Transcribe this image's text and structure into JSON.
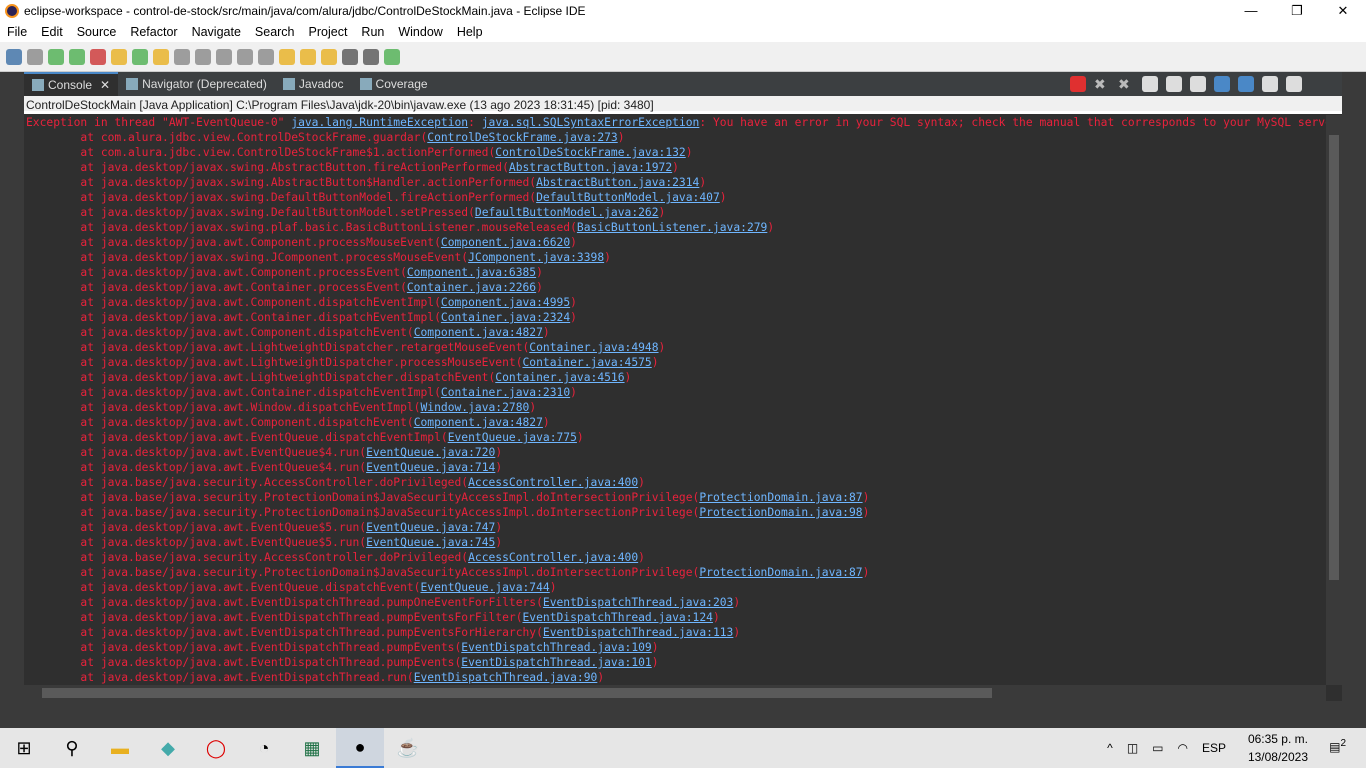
{
  "window": {
    "title": "eclipse-workspace - control-de-stock/src/main/java/com/alura/jdbc/ControlDeStockMain.java - Eclipse IDE",
    "minimize": "—",
    "maximize": "❐",
    "close": "✕"
  },
  "menu": [
    "File",
    "Edit",
    "Source",
    "Refactor",
    "Navigate",
    "Search",
    "Project",
    "Run",
    "Window",
    "Help"
  ],
  "tabs": [
    {
      "label": "Console",
      "icon": "console-icon",
      "active": true
    },
    {
      "label": "Navigator (Deprecated)",
      "icon": "navigator-icon"
    },
    {
      "label": "Javadoc",
      "icon": "javadoc-icon"
    },
    {
      "label": "Coverage",
      "icon": "coverage-icon"
    }
  ],
  "process_line": "ControlDeStockMain [Java Application] C:\\Program Files\\Java\\jdk-20\\bin\\javaw.exe  (13 ago 2023 18:31:45) [pid: 3480]",
  "console": {
    "exception_prefix": "Exception in thread \"AWT-EventQueue-0\" ",
    "exception_class": "java.lang.RuntimeException",
    "exception_sep": ": ",
    "cause_class": "java.sql.SQLSyntaxErrorException",
    "message": ": You have an error in your SQL syntax; check the manual that corresponds to your MySQL server version",
    "frames": [
      [
        "com.alura.jdbc.view.ControlDeStockFrame.guardar",
        "ControlDeStockFrame.java:273"
      ],
      [
        "com.alura.jdbc.view.ControlDeStockFrame$1.actionPerformed",
        "ControlDeStockFrame.java:132"
      ],
      [
        "java.desktop/javax.swing.AbstractButton.fireActionPerformed",
        "AbstractButton.java:1972"
      ],
      [
        "java.desktop/javax.swing.AbstractButton$Handler.actionPerformed",
        "AbstractButton.java:2314"
      ],
      [
        "java.desktop/javax.swing.DefaultButtonModel.fireActionPerformed",
        "DefaultButtonModel.java:407"
      ],
      [
        "java.desktop/javax.swing.DefaultButtonModel.setPressed",
        "DefaultButtonModel.java:262"
      ],
      [
        "java.desktop/javax.swing.plaf.basic.BasicButtonListener.mouseReleased",
        "BasicButtonListener.java:279"
      ],
      [
        "java.desktop/java.awt.Component.processMouseEvent",
        "Component.java:6620"
      ],
      [
        "java.desktop/javax.swing.JComponent.processMouseEvent",
        "JComponent.java:3398"
      ],
      [
        "java.desktop/java.awt.Component.processEvent",
        "Component.java:6385"
      ],
      [
        "java.desktop/java.awt.Container.processEvent",
        "Container.java:2266"
      ],
      [
        "java.desktop/java.awt.Component.dispatchEventImpl",
        "Component.java:4995"
      ],
      [
        "java.desktop/java.awt.Container.dispatchEventImpl",
        "Container.java:2324"
      ],
      [
        "java.desktop/java.awt.Component.dispatchEvent",
        "Component.java:4827"
      ],
      [
        "java.desktop/java.awt.LightweightDispatcher.retargetMouseEvent",
        "Container.java:4948"
      ],
      [
        "java.desktop/java.awt.LightweightDispatcher.processMouseEvent",
        "Container.java:4575"
      ],
      [
        "java.desktop/java.awt.LightweightDispatcher.dispatchEvent",
        "Container.java:4516"
      ],
      [
        "java.desktop/java.awt.Container.dispatchEventImpl",
        "Container.java:2310"
      ],
      [
        "java.desktop/java.awt.Window.dispatchEventImpl",
        "Window.java:2780"
      ],
      [
        "java.desktop/java.awt.Component.dispatchEvent",
        "Component.java:4827"
      ],
      [
        "java.desktop/java.awt.EventQueue.dispatchEventImpl",
        "EventQueue.java:775"
      ],
      [
        "java.desktop/java.awt.EventQueue$4.run",
        "EventQueue.java:720"
      ],
      [
        "java.desktop/java.awt.EventQueue$4.run",
        "EventQueue.java:714"
      ],
      [
        "java.base/java.security.AccessController.doPrivileged",
        "AccessController.java:400"
      ],
      [
        "java.base/java.security.ProtectionDomain$JavaSecurityAccessImpl.doIntersectionPrivilege",
        "ProtectionDomain.java:87"
      ],
      [
        "java.base/java.security.ProtectionDomain$JavaSecurityAccessImpl.doIntersectionPrivilege",
        "ProtectionDomain.java:98"
      ],
      [
        "java.desktop/java.awt.EventQueue$5.run",
        "EventQueue.java:747"
      ],
      [
        "java.desktop/java.awt.EventQueue$5.run",
        "EventQueue.java:745"
      ],
      [
        "java.base/java.security.AccessController.doPrivileged",
        "AccessController.java:400"
      ],
      [
        "java.base/java.security.ProtectionDomain$JavaSecurityAccessImpl.doIntersectionPrivilege",
        "ProtectionDomain.java:87"
      ],
      [
        "java.desktop/java.awt.EventQueue.dispatchEvent",
        "EventQueue.java:744"
      ],
      [
        "java.desktop/java.awt.EventDispatchThread.pumpOneEventForFilters",
        "EventDispatchThread.java:203"
      ],
      [
        "java.desktop/java.awt.EventDispatchThread.pumpEventsForFilter",
        "EventDispatchThread.java:124"
      ],
      [
        "java.desktop/java.awt.EventDispatchThread.pumpEventsForHierarchy",
        "EventDispatchThread.java:113"
      ],
      [
        "java.desktop/java.awt.EventDispatchThread.pumpEvents",
        "EventDispatchThread.java:109"
      ],
      [
        "java.desktop/java.awt.EventDispatchThread.pumpEvents",
        "EventDispatchThread.java:101"
      ],
      [
        "java.desktop/java.awt.EventDispatchThread.run",
        "EventDispatchThread.java:90"
      ]
    ]
  },
  "colors": {
    "error": "#e8223c",
    "link": "#6fb6ff",
    "console_bg": "#2f2f2f"
  },
  "taskbar": {
    "language": "ESP",
    "time": "06:35 p. m.",
    "date": "13/08/2023",
    "notifications": "2"
  }
}
